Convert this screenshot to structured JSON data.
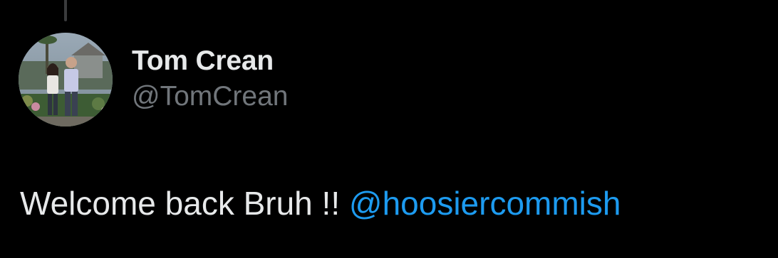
{
  "tweet": {
    "author": {
      "display_name": "Tom Crean",
      "handle": "@TomCrean"
    },
    "text": "Welcome back Bruh !!",
    "mention": "@hoosiercommish"
  },
  "colors": {
    "background": "#000000",
    "primary_text": "#e7e9ea",
    "secondary_text": "#71767b",
    "link": "#1d9bf0",
    "thread_line": "#3a3b3d"
  },
  "icons": {
    "avatar": "profile-photo"
  }
}
